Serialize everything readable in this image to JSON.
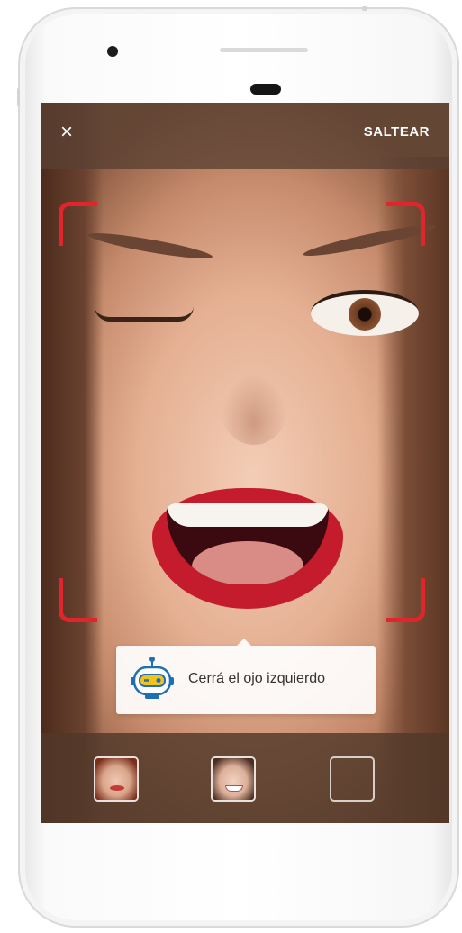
{
  "header": {
    "close_icon": "×",
    "skip_label": "SALTEAR"
  },
  "instruction": {
    "text": "Cerrá el ojo izquierdo",
    "mascot_icon": "robot-icon"
  },
  "steps": [
    {
      "name": "step-1-thumbnail",
      "state": "done"
    },
    {
      "name": "step-2-thumbnail",
      "state": "current"
    },
    {
      "name": "step-3-thumbnail",
      "state": "pending"
    }
  ],
  "colors": {
    "frame_corner": "#e0262c",
    "overlay_bar": "#5a4032",
    "text_light": "#ffffff"
  }
}
